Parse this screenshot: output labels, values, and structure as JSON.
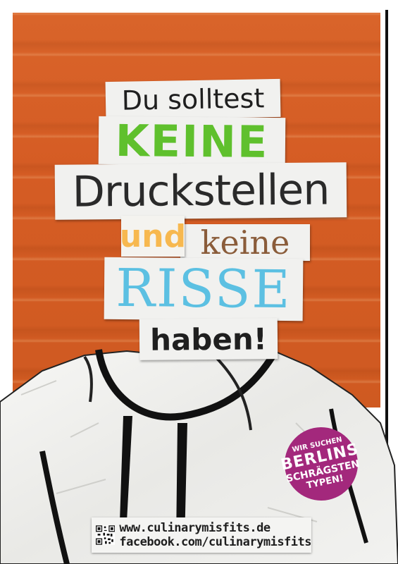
{
  "headline": {
    "line1": "Du solltest",
    "line2": "KEINE",
    "line3": "Druckstellen",
    "line4a": "und",
    "line4b": "keine",
    "line5": "RISSE",
    "line6": "haben!"
  },
  "badge": {
    "line1": "WIR SUCHEN",
    "line2": "BERLINS",
    "line3": "SCHRÄGSTEN",
    "line4": "TYPEN!"
  },
  "footer": {
    "website": "www.culinarymisfits.de",
    "facebook": "facebook.com/culinarymisfits",
    "qr_icon": "qr-code-icon"
  },
  "colors": {
    "background": "#d85f26",
    "keine_green": "#5fc02d",
    "und_orange": "#f7b84f",
    "keine_brown": "#8a5c3a",
    "risse_blue": "#5cc0e2",
    "badge_purple": "#a3287c"
  }
}
